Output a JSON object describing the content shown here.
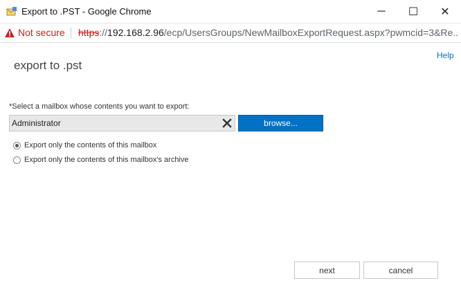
{
  "window": {
    "title": "Export to .PST - Google Chrome",
    "icon": "envelope-app-icon",
    "minimize_glyph": "─",
    "maximize_glyph": "☐",
    "close_glyph": "✕"
  },
  "address_bar": {
    "security_label": "Not secure",
    "url_scheme": "https",
    "url_separator": "://",
    "url_host": "192.168.2.96",
    "url_path": "/ecp/UsersGroups/NewMailboxExportRequest.aspx?pwmcid=3&Re..."
  },
  "page": {
    "help_label": "Help",
    "title": "export to .pst",
    "select_label": "*Select a mailbox whose contents you want to export:",
    "mailbox_value": "Administrator",
    "browse_label": "browse...",
    "options": [
      {
        "label": "Export only the contents of this mailbox",
        "checked": true
      },
      {
        "label": "Export only the contents of this mailbox's archive",
        "checked": false
      }
    ],
    "next_label": "next",
    "cancel_label": "cancel"
  },
  "colors": {
    "accent": "#0072c6",
    "warning": "#c5221f"
  }
}
